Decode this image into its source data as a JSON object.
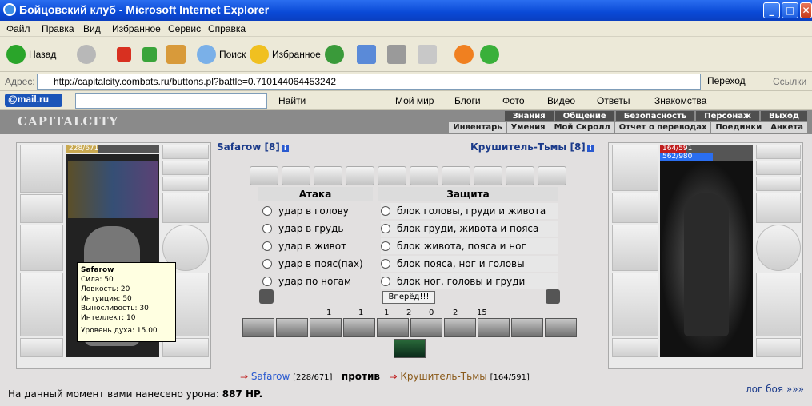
{
  "window": {
    "title": "Бойцовский клуб - Microsoft Internet Explorer",
    "min": "_",
    "max": "□",
    "close": "✕"
  },
  "menu": [
    "Файл",
    "Правка",
    "Вид",
    "Избранное",
    "Сервис",
    "Справка"
  ],
  "toolbar": {
    "back": "Назад",
    "search": "Поиск",
    "favorites": "Избранное"
  },
  "address": {
    "label": "Адрес:",
    "url": "http://capitalcity.combats.ru/buttons.pl?battle=0.710144064453242",
    "go": "Переход",
    "links": "Ссылки"
  },
  "mailbar": {
    "logo": "@mail.ru",
    "find": "Найти",
    "items": [
      "Мой мир",
      "Блоги",
      "Фото",
      "Видео",
      "Ответы",
      "Знакомства"
    ]
  },
  "game_header": {
    "brand": "CAPITALCITY",
    "nav1": [
      "Знания",
      "Общение",
      "Безопасность",
      "Персонаж",
      "Выход"
    ],
    "nav2": [
      "Инвентарь",
      "Умения",
      "Мой Скролл",
      "Отчет о переводах",
      "Поединки",
      "Анкета"
    ]
  },
  "player": {
    "name": "Safarow",
    "level": "[8]",
    "hp": "228/671",
    "hp_fraction": 0.34,
    "tooltip": {
      "name": "Safarow",
      "lines": [
        "Сила: 50",
        "Ловкость: 20",
        "Интуиция: 50",
        "Выносливость: 30",
        "Интеллект: 10"
      ],
      "spirit": "Уровень духа: 15.00"
    }
  },
  "enemy": {
    "name": "Крушитель-Тьмы",
    "level": "[8]",
    "hp": "164/591",
    "hp_fraction": 0.28,
    "mana": "562/980",
    "mana_fraction": 0.57
  },
  "attack": {
    "title": "Атака",
    "options": [
      "удар в голову",
      "удар в грудь",
      "удар в живот",
      "удар в пояс(пах)",
      "удар по ногам"
    ]
  },
  "defense": {
    "title": "Защита",
    "options": [
      "блок головы, груди и живота",
      "блок груди, живота и пояса",
      "блок живота, пояса и ног",
      "блок пояса, ног и головы",
      "блок ног, головы и груди"
    ]
  },
  "forward_button": "Вперёд!!!",
  "stats_row": [
    "1",
    "1",
    "1",
    "2",
    "0",
    "2",
    "15"
  ],
  "bottom": {
    "player_name": "Safarow",
    "player_hp": "[228/671]",
    "vs": "против",
    "enemy_name": "Крушитель-Тьмы",
    "enemy_hp": "[164/591]",
    "damage_text": "На данный момент вами нанесено урона:",
    "damage_value": "887 HP.",
    "log_link": "лог боя »»»"
  },
  "colors": {
    "xp_blue": "#0a49d6",
    "hp_red": "#c01e1e",
    "mana_blue": "#2a6ef0",
    "name_blue": "#1a3a8a"
  }
}
